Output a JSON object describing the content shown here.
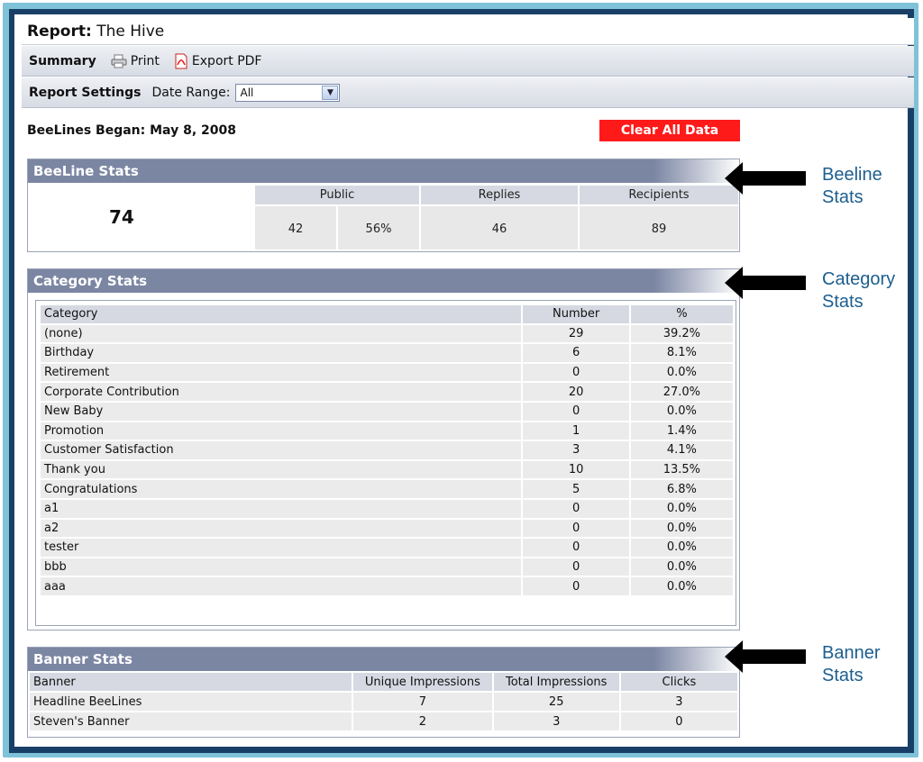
{
  "report": {
    "label": "Report:",
    "name": "The Hive"
  },
  "toolbar": {
    "summary_label": "Summary",
    "print_label": "Print",
    "export_label": "Export PDF"
  },
  "settings": {
    "label": "Report Settings",
    "date_range_label": "Date Range:",
    "date_range_value": "All"
  },
  "began": "BeeLines Began: May 8, 2008",
  "clear_button": "Clear All Data",
  "beeline_stats": {
    "title": "BeeLine Stats",
    "total": "74",
    "headers": {
      "public": "Public",
      "replies": "Replies",
      "recipients": "Recipients"
    },
    "public_count": "42",
    "public_pct": "56%",
    "replies": "46",
    "recipients": "89"
  },
  "category_stats": {
    "title": "Category Stats",
    "headers": {
      "category": "Category",
      "number": "Number",
      "pct": "%"
    },
    "rows": [
      {
        "category": "(none)",
        "number": "29",
        "pct": "39.2%"
      },
      {
        "category": "Birthday",
        "number": "6",
        "pct": "8.1%"
      },
      {
        "category": "Retirement",
        "number": "0",
        "pct": "0.0%"
      },
      {
        "category": "Corporate Contribution",
        "number": "20",
        "pct": "27.0%"
      },
      {
        "category": "New Baby",
        "number": "0",
        "pct": "0.0%"
      },
      {
        "category": "Promotion",
        "number": "1",
        "pct": "1.4%"
      },
      {
        "category": "Customer Satisfaction",
        "number": "3",
        "pct": "4.1%"
      },
      {
        "category": "Thank you",
        "number": "10",
        "pct": "13.5%"
      },
      {
        "category": "Congratulations",
        "number": "5",
        "pct": "6.8%"
      },
      {
        "category": "a1",
        "number": "0",
        "pct": "0.0%"
      },
      {
        "category": "a2",
        "number": "0",
        "pct": "0.0%"
      },
      {
        "category": "tester",
        "number": "0",
        "pct": "0.0%"
      },
      {
        "category": "bbb",
        "number": "0",
        "pct": "0.0%"
      },
      {
        "category": "aaa",
        "number": "0",
        "pct": "0.0%"
      }
    ]
  },
  "banner_stats": {
    "title": "Banner Stats",
    "headers": {
      "banner": "Banner",
      "unique": "Unique Impressions",
      "total": "Total Impressions",
      "clicks": "Clicks"
    },
    "rows": [
      {
        "banner": "Headline BeeLines",
        "unique": "7",
        "total": "25",
        "clicks": "3"
      },
      {
        "banner": "Steven's Banner",
        "unique": "2",
        "total": "3",
        "clicks": "0"
      }
    ]
  },
  "annotations": {
    "beeline": {
      "line1": "Beeline",
      "line2": "Stats"
    },
    "category": {
      "line1": "Category",
      "line2": "Stats"
    },
    "banner": {
      "line1": "Banner",
      "line2": "Stats"
    }
  },
  "colors": {
    "frame_outer": "#7fc3d9",
    "frame_inner": "#1a3f67",
    "panel_header": "#7b86a3",
    "clear_button": "#ff1a1a",
    "annotation_text": "#1c5e8f"
  }
}
